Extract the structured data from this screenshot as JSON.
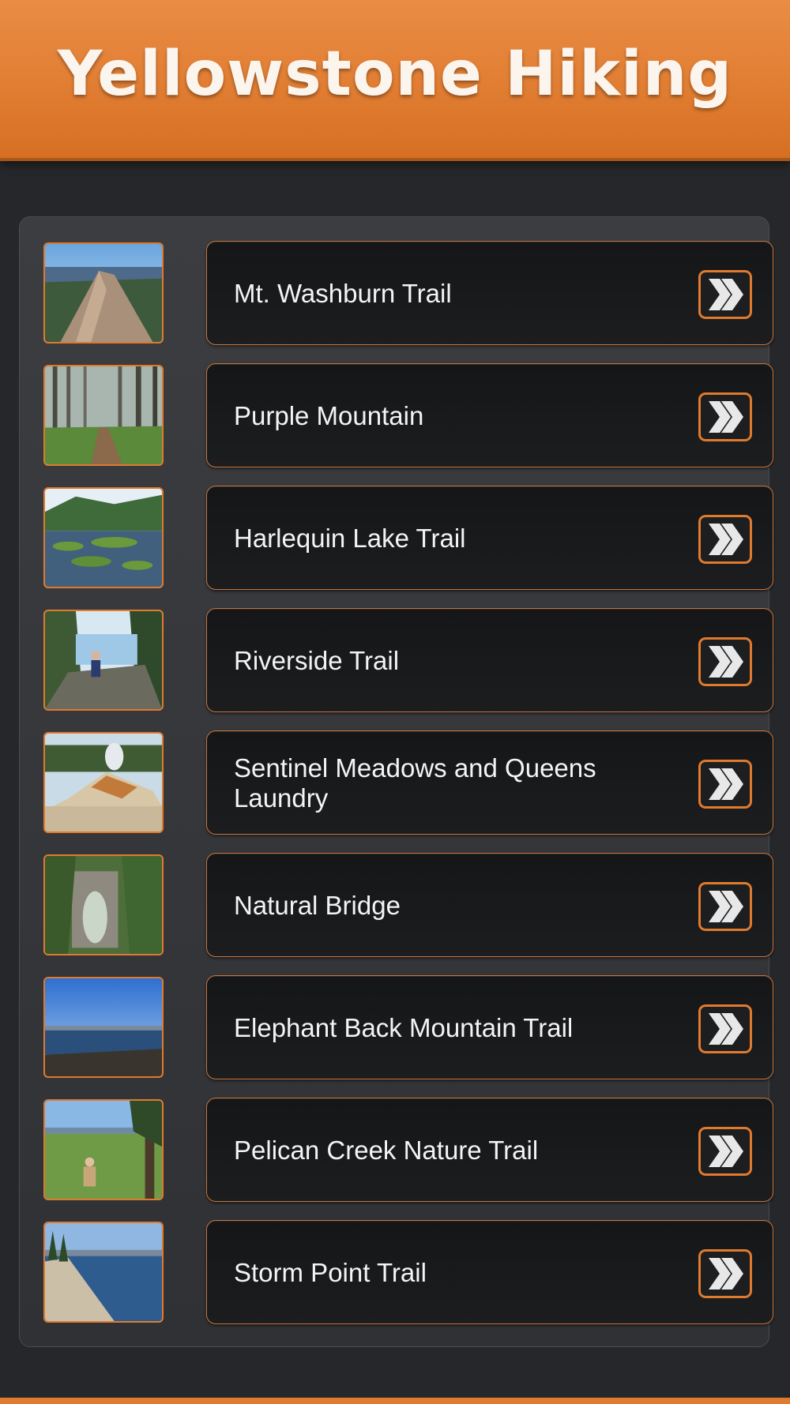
{
  "app": {
    "title": "Yellowstone Hiking"
  },
  "colors": {
    "accent": "#e07a2e",
    "background": "#26272b",
    "card": "#1a1b1d",
    "text": "#f4f4f4"
  },
  "trails": [
    {
      "label": "Mt. Washburn Trail",
      "thumb_icon": "mountain-ridge-photo"
    },
    {
      "label": "Purple Mountain",
      "thumb_icon": "forest-path-photo"
    },
    {
      "label": "Harlequin Lake Trail",
      "thumb_icon": "lily-pad-lake-photo"
    },
    {
      "label": "Riverside Trail",
      "thumb_icon": "river-hiker-photo"
    },
    {
      "label": "Sentinel Meadows and Queens Laundry",
      "thumb_icon": "geyser-mound-photo"
    },
    {
      "label": "Natural Bridge",
      "thumb_icon": "rock-arch-photo"
    },
    {
      "label": "Elephant Back Mountain Trail",
      "thumb_icon": "lake-vista-photo"
    },
    {
      "label": "Pelican Creek Nature Trail",
      "thumb_icon": "meadow-hiker-photo"
    },
    {
      "label": "Storm Point Trail",
      "thumb_icon": "lakeshore-photo"
    }
  ],
  "icons": {
    "row_button": "double-chevron-right-icon"
  }
}
